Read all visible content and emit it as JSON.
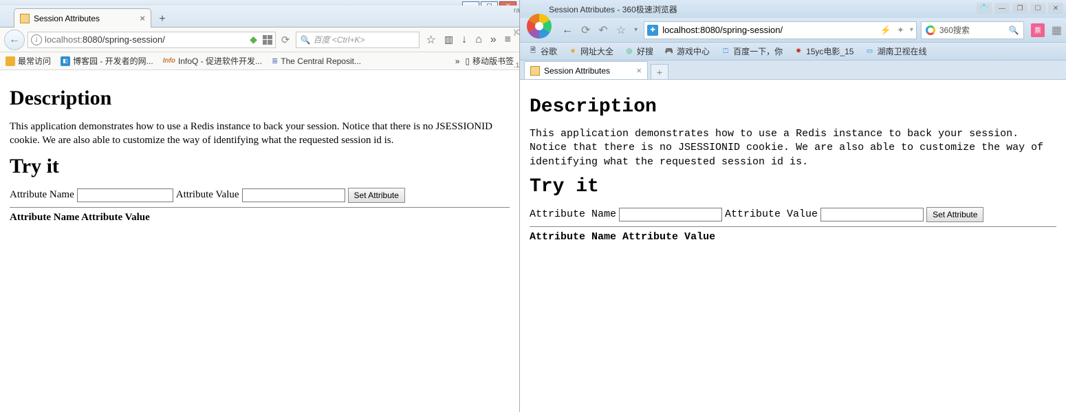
{
  "left": {
    "tab_title": "Session Attributes",
    "url_display_host": "localhost:",
    "url_display_rest": "8080/spring-session/",
    "search_placeholder": "百度 <Ctrl+K>",
    "bookmarks": {
      "most_visited": "最常访问",
      "cnblogs": "博客园 - 开发者的网...",
      "infoq": "InfoQ - 促进软件开发...",
      "central": "The Central Reposit...",
      "mobile": "移动版书签"
    },
    "winbtns": {
      "min": "—",
      "max": "☐",
      "close": "X"
    }
  },
  "right": {
    "window_title": "Session Attributes - 360极速浏览器",
    "url": "localhost:8080/spring-session/",
    "search_label": "360搜索",
    "ticket": "票",
    "bookmarks": {
      "google": "谷歌",
      "sites": "网址大全",
      "haosou": "好搜",
      "games": "游戏中心",
      "baidu": "百度一下，你",
      "yc": "15yc电影_15",
      "hunan": "湖南卫视在线"
    },
    "tab_title": "Session Attributes",
    "winbtns": {
      "skin": "👕",
      "min": "—",
      "restore": "❐",
      "max": "☐",
      "close": "✕"
    }
  },
  "page": {
    "h_desc": "Description",
    "desc_text": "This application demonstrates how to use a Redis instance to back your session. Notice that there is no JSESSIONID cookie. We are also able to customize the way of identifying what the requested session id is.",
    "h_try": "Try it",
    "label_name": "Attribute Name",
    "label_value": "Attribute Value",
    "btn_set": "Set Attribute",
    "th_name": "Attribute Name",
    "th_value": "Attribute Value"
  }
}
